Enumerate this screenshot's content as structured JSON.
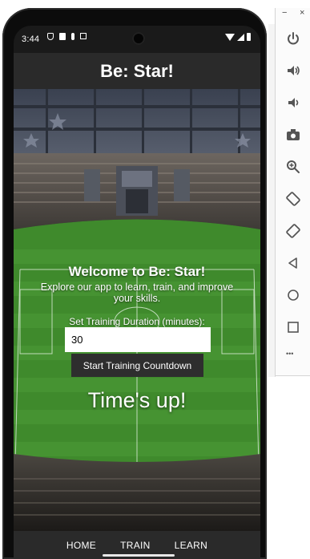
{
  "statusbar": {
    "time": "3:44"
  },
  "app": {
    "title": "Be: Star!"
  },
  "main": {
    "welcome": "Welcome to Be: Star!",
    "tagline": "Explore our app to learn, train, and improve your skills.",
    "duration_label": "Set Training Duration (minutes):",
    "duration_value": "30",
    "start_button": "Start Training Countdown",
    "status_message": "Time's up!"
  },
  "nav": {
    "items": [
      "HOME",
      "TRAIN",
      "LEARN"
    ]
  },
  "emulator": {
    "window_minimize": "−",
    "window_close": "×",
    "toolbar_icons": [
      "power-icon",
      "volume-up-icon",
      "volume-down-icon",
      "camera-icon",
      "zoom-icon",
      "rotate-left-icon",
      "rotate-right-icon",
      "back-icon",
      "home-icon",
      "overview-icon",
      "more-icon"
    ],
    "more_label": "•••"
  },
  "colors": {
    "bar": "#2a2a2a",
    "button": "#2e2e2e",
    "pitch": "#3f8a2c",
    "toolbar_icon": "#555555"
  }
}
